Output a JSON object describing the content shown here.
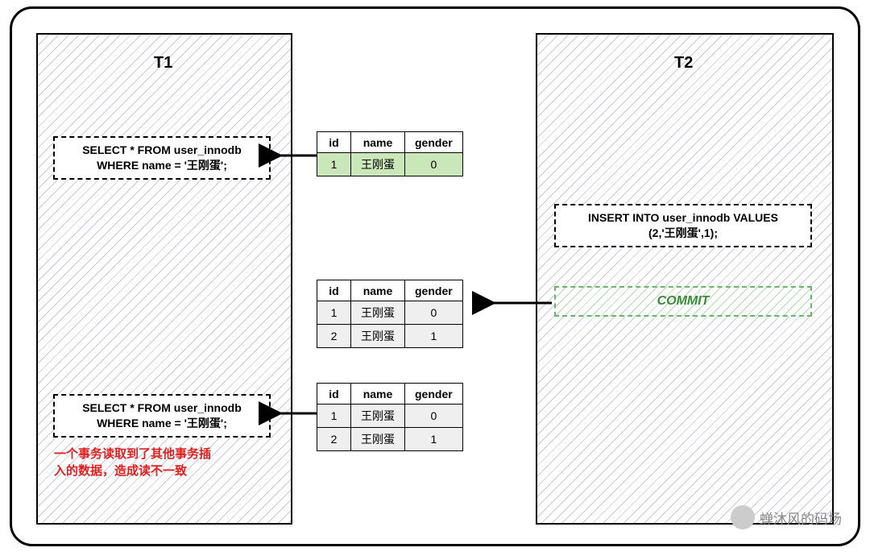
{
  "tx": {
    "t1": "T1",
    "t2": "T2"
  },
  "sql": {
    "select": "SELECT * FROM user_innodb\nWHERE name = '王刚蛋';",
    "insert": "INSERT INTO user_innodb VALUES\n(2,'王刚蛋',1);"
  },
  "commit": "COMMIT",
  "redtext": "一个事务读取到了其他事务插\n入的数据，造成读不一致",
  "headers": {
    "id": "id",
    "name": "name",
    "gender": "gender"
  },
  "table1": [
    {
      "id": "1",
      "name": "王刚蛋",
      "gender": "0"
    }
  ],
  "table2": [
    {
      "id": "1",
      "name": "王刚蛋",
      "gender": "0"
    },
    {
      "id": "2",
      "name": "王刚蛋",
      "gender": "1"
    }
  ],
  "table3": [
    {
      "id": "1",
      "name": "王刚蛋",
      "gender": "0"
    },
    {
      "id": "2",
      "name": "王刚蛋",
      "gender": "1"
    }
  ],
  "watermark": "蝉沐风的码场"
}
